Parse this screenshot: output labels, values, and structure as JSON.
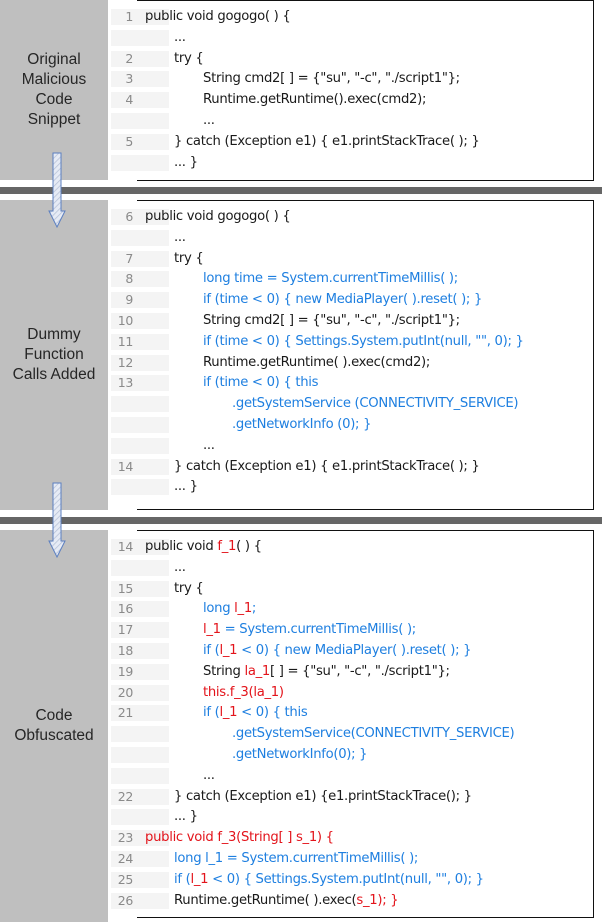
{
  "stages": [
    {
      "label": [
        "Original",
        "Malicious",
        "Code",
        "Snippet"
      ],
      "lines": [
        {
          "num": "1",
          "indent": 0,
          "segments": [
            {
              "t": "public void gogogo( ) {",
              "c": "black"
            }
          ]
        },
        {
          "num": "",
          "indent": 1,
          "segments": [
            {
              "t": "...",
              "c": "black"
            }
          ]
        },
        {
          "num": "2",
          "indent": 1,
          "segments": [
            {
              "t": "try {",
              "c": "black"
            }
          ]
        },
        {
          "num": "3",
          "indent": 2,
          "segments": [
            {
              "t": "String cmd2[ ] = {\"su\", \"-c\", \"./script1\"};",
              "c": "black"
            }
          ]
        },
        {
          "num": "4",
          "indent": 2,
          "segments": [
            {
              "t": "Runtime.getRuntime().exec(cmd2);",
              "c": "black"
            }
          ]
        },
        {
          "num": "",
          "indent": 2,
          "segments": [
            {
              "t": "...",
              "c": "black"
            }
          ]
        },
        {
          "num": "5",
          "indent": 1,
          "segments": [
            {
              "t": "} catch (Exception e1) { e1.printStackTrace( ); }",
              "c": "black"
            }
          ]
        },
        {
          "num": "",
          "indent": 1,
          "segments": [
            {
              "t": "... }",
              "c": "black"
            }
          ]
        }
      ]
    },
    {
      "label": [
        "Dummy",
        "Function",
        "Calls Added"
      ],
      "lines": [
        {
          "num": "6",
          "indent": 0,
          "segments": [
            {
              "t": "public void gogogo( ) {",
              "c": "black"
            }
          ]
        },
        {
          "num": "",
          "indent": 1,
          "segments": [
            {
              "t": "...",
              "c": "black"
            }
          ]
        },
        {
          "num": "7",
          "indent": 1,
          "segments": [
            {
              "t": "try {",
              "c": "black"
            }
          ]
        },
        {
          "num": "8",
          "indent": 2,
          "segments": [
            {
              "t": "long time = System.currentTimeMillis( );",
              "c": "blue"
            }
          ]
        },
        {
          "num": "9",
          "indent": 2,
          "segments": [
            {
              "t": "if (time < 0) { new MediaPlayer( ).reset( ); }",
              "c": "blue"
            }
          ]
        },
        {
          "num": "10",
          "indent": 2,
          "segments": [
            {
              "t": "String cmd2[ ] = {\"su\", \"-c\", \"./script1\"};",
              "c": "black"
            }
          ]
        },
        {
          "num": "11",
          "indent": 2,
          "segments": [
            {
              "t": "if (time < 0) { Settings.System.putInt(null, \"\", 0); }",
              "c": "blue"
            }
          ]
        },
        {
          "num": "12",
          "indent": 2,
          "segments": [
            {
              "t": "Runtime.getRuntime( ).exec(cmd2);",
              "c": "black"
            }
          ]
        },
        {
          "num": "13",
          "indent": 2,
          "segments": [
            {
              "t": "if (time < 0) { this",
              "c": "blue"
            }
          ]
        },
        {
          "num": "",
          "indent": 3,
          "segments": [
            {
              "t": ".getSystemService (CONNECTIVITY_SERVICE)",
              "c": "blue"
            }
          ]
        },
        {
          "num": "",
          "indent": 3,
          "segments": [
            {
              "t": ".getNetworkInfo (0); }",
              "c": "blue"
            }
          ]
        },
        {
          "num": "",
          "indent": 2,
          "segments": [
            {
              "t": "...",
              "c": "black"
            }
          ]
        },
        {
          "num": "14",
          "indent": 1,
          "segments": [
            {
              "t": "} catch (Exception e1) { e1.printStackTrace( ); }",
              "c": "black"
            }
          ]
        },
        {
          "num": "",
          "indent": 1,
          "segments": [
            {
              "t": "... }",
              "c": "black"
            }
          ]
        }
      ]
    },
    {
      "label": [
        "Code",
        "Obfuscated"
      ],
      "lines": [
        {
          "num": "14",
          "indent": 0,
          "segments": [
            {
              "t": "public void ",
              "c": "black"
            },
            {
              "t": "f_1",
              "c": "red"
            },
            {
              "t": "( ) {",
              "c": "black"
            }
          ]
        },
        {
          "num": "",
          "indent": 1,
          "segments": [
            {
              "t": "...",
              "c": "black"
            }
          ]
        },
        {
          "num": "15",
          "indent": 1,
          "segments": [
            {
              "t": "try {",
              "c": "black"
            }
          ]
        },
        {
          "num": "16",
          "indent": 2,
          "segments": [
            {
              "t": "long ",
              "c": "blue"
            },
            {
              "t": "l_1",
              "c": "red"
            },
            {
              "t": ";",
              "c": "blue"
            }
          ]
        },
        {
          "num": "17",
          "indent": 2,
          "segments": [
            {
              "t": "l_1",
              "c": "red"
            },
            {
              "t": " = System.currentTimeMillis( );",
              "c": "blue"
            }
          ]
        },
        {
          "num": "18",
          "indent": 2,
          "segments": [
            {
              "t": "if (",
              "c": "blue"
            },
            {
              "t": "l_1",
              "c": "red"
            },
            {
              "t": " < 0) { new MediaPlayer( ).reset( ); }",
              "c": "blue"
            }
          ]
        },
        {
          "num": "19",
          "indent": 2,
          "segments": [
            {
              "t": "String ",
              "c": "black"
            },
            {
              "t": "la_1",
              "c": "red"
            },
            {
              "t": "[ ] = {\"su\", \"-c\", \"./script1\"};",
              "c": "black"
            }
          ]
        },
        {
          "num": "20",
          "indent": 2,
          "segments": [
            {
              "t": "this.f_3(la_1)",
              "c": "red"
            }
          ]
        },
        {
          "num": "21",
          "indent": 2,
          "segments": [
            {
              "t": "if (",
              "c": "blue"
            },
            {
              "t": "l_1",
              "c": "red"
            },
            {
              "t": " < 0) { this",
              "c": "blue"
            }
          ]
        },
        {
          "num": "",
          "indent": 3,
          "segments": [
            {
              "t": ".getSystemService(CONNECTIVITY_SERVICE)",
              "c": "blue"
            }
          ]
        },
        {
          "num": "",
          "indent": 3,
          "segments": [
            {
              "t": ".getNetworkInfo(0); }",
              "c": "blue"
            }
          ]
        },
        {
          "num": "",
          "indent": 2,
          "segments": [
            {
              "t": "...",
              "c": "black"
            }
          ]
        },
        {
          "num": "22",
          "indent": 1,
          "segments": [
            {
              "t": "} catch (Exception e1) {e1.printStackTrace(); }",
              "c": "black"
            }
          ]
        },
        {
          "num": "",
          "indent": 1,
          "segments": [
            {
              "t": "... }",
              "c": "black"
            }
          ]
        },
        {
          "num": "23",
          "indent": 0,
          "segments": [
            {
              "t": "public void f_3(String[ ] s_1) {",
              "c": "red"
            }
          ]
        },
        {
          "num": "24",
          "indent": 1,
          "segments": [
            {
              "t": "long l_1 = System.currentTimeMillis( );",
              "c": "blue"
            }
          ]
        },
        {
          "num": "25",
          "indent": 1,
          "segments": [
            {
              "t": "if (",
              "c": "blue"
            },
            {
              "t": "l_1",
              "c": "red"
            },
            {
              "t": " < 0) { Settings.System.putInt(null, \"\", 0); }",
              "c": "blue"
            }
          ]
        },
        {
          "num": "26",
          "indent": 1,
          "segments": [
            {
              "t": "Runtime.getRuntime( ).exec(",
              "c": "black"
            },
            {
              "t": "s_1",
              "c": "red"
            },
            {
              "t": "); }",
              "c": "red"
            }
          ]
        }
      ]
    }
  ],
  "colors": {
    "black": "#1a1a1a",
    "blue": "#1e7fe0",
    "red": "#e3141b",
    "label_bg": "#bfbfbf",
    "separator": "#666666",
    "arrow": "#5b7fc0"
  }
}
